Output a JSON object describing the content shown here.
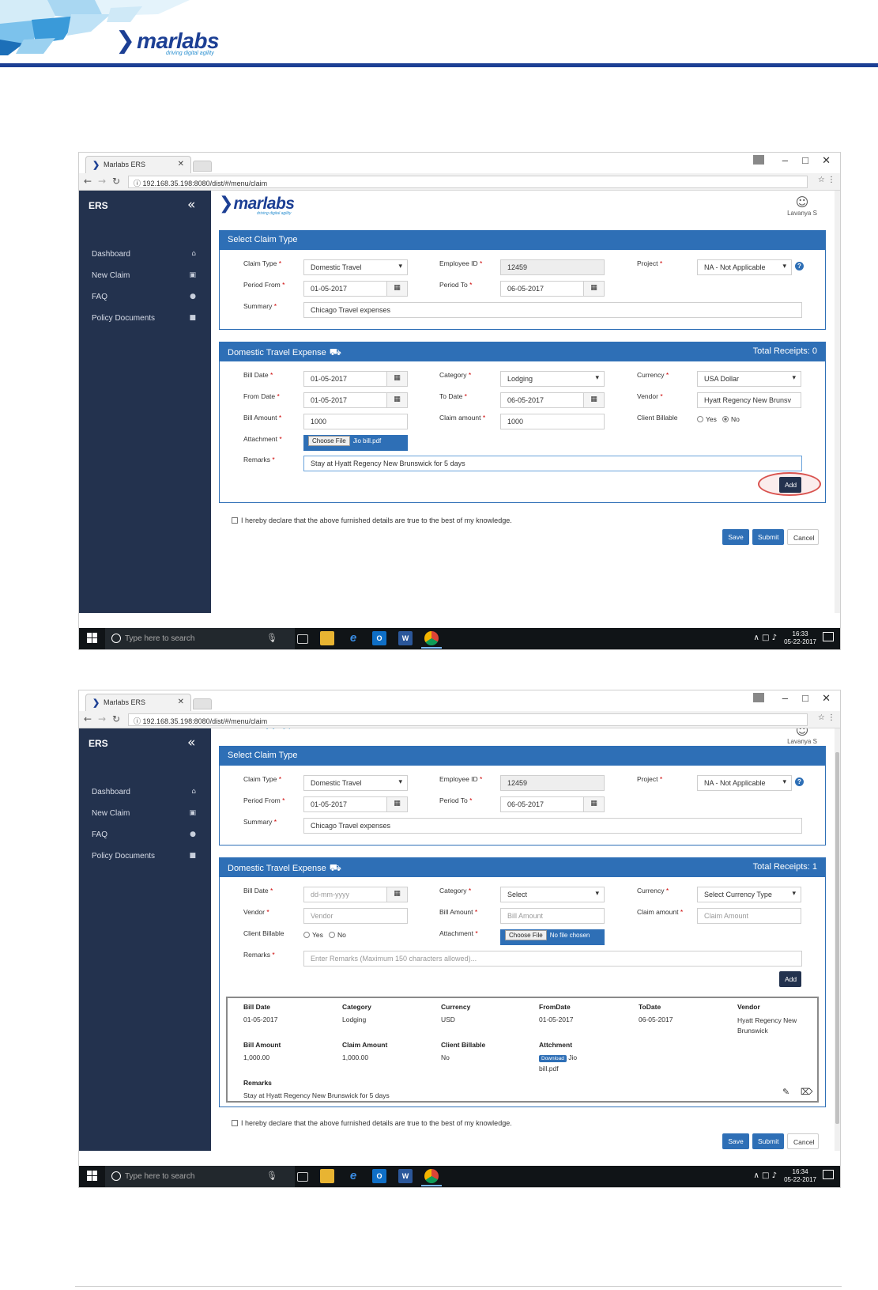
{
  "doc": {
    "logo_text": "marlabs",
    "logo_tagline": "driving digital agility"
  },
  "browser": {
    "tab_title": "Marlabs ERS",
    "url": "192.168.35.198:8080/dist/#/menu/claim"
  },
  "sidebar": {
    "title": "ERS",
    "items": [
      {
        "label": "Dashboard",
        "icon": "home-icon"
      },
      {
        "label": "New Claim",
        "icon": "claim-icon"
      },
      {
        "label": "FAQ",
        "icon": "help-icon"
      },
      {
        "label": "Policy Documents",
        "icon": "file-icon"
      }
    ]
  },
  "app": {
    "logo_text": "marlabs",
    "logo_tagline": "driving digital agility",
    "user_name": "Lavanya S"
  },
  "claim_panel": {
    "title": "Select Claim Type",
    "claim_type_label": "Claim Type",
    "claim_type_value": "Domestic Travel",
    "employee_id_label": "Employee ID",
    "employee_id_value": "12459",
    "project_label": "Project",
    "project_value": "NA - Not Applicable",
    "period_from_label": "Period From",
    "period_from_value": "01-05-2017",
    "period_to_label": "Period To",
    "period_to_value": "06-05-2017",
    "summary_label": "Summary",
    "summary_value": "Chicago Travel expenses"
  },
  "expense_panel_1": {
    "title": "Domestic Travel Expense",
    "total_receipts": "Total Receipts: 0",
    "bill_date_label": "Bill Date",
    "bill_date_value": "01-05-2017",
    "category_label": "Category",
    "category_value": "Lodging",
    "currency_label": "Currency",
    "currency_value": "USA Dollar",
    "from_date_label": "From Date",
    "from_date_value": "01-05-2017",
    "to_date_label": "To Date",
    "to_date_value": "06-05-2017",
    "vendor_label": "Vendor",
    "vendor_value": "Hyatt Regency New Brunsv",
    "bill_amount_label": "Bill Amount",
    "bill_amount_value": "1000",
    "claim_amount_label": "Claim amount",
    "claim_amount_value": "1000",
    "client_billable_label": "Client Billable",
    "yes_label": "Yes",
    "no_label": "No",
    "attachment_label": "Attachment",
    "choose_file": "Choose File",
    "file_name": "Jio bill.pdf",
    "remarks_label": "Remarks",
    "remarks_value": "Stay at Hyatt Regency New Brunswick for 5 days",
    "add_button": "Add"
  },
  "expense_panel_2": {
    "title": "Domestic Travel Expense",
    "total_receipts": "Total Receipts: 1",
    "bill_date_label": "Bill Date",
    "bill_date_placeholder": "dd-mm-yyyy",
    "category_label": "Category",
    "category_value": "Select",
    "currency_label": "Currency",
    "currency_value": "Select Currency Type",
    "vendor_label": "Vendor",
    "vendor_placeholder": "Vendor",
    "bill_amount_label": "Bill Amount",
    "bill_amount_placeholder": "Bill Amount",
    "claim_amount_label": "Claim amount",
    "claim_amount_placeholder": "Claim Amount",
    "client_billable_label": "Client Billable",
    "yes_label": "Yes",
    "no_label": "No",
    "attachment_label": "Attachment",
    "choose_file": "Choose File",
    "file_name": "No file chosen",
    "remarks_label": "Remarks",
    "remarks_placeholder": "Enter Remarks (Maximum 150 characters allowed)...",
    "add_button": "Add"
  },
  "receipt": {
    "headers": [
      "Bill Date",
      "Category",
      "Currency",
      "FromDate",
      "ToDate",
      "Vendor"
    ],
    "values": [
      "01-05-2017",
      "Lodging",
      "USD",
      "01-05-2017",
      "06-05-2017",
      "Hyatt Regency New Brunswick"
    ],
    "headers2": [
      "Bill Amount",
      "Claim Amount",
      "Client Billable",
      "Attchment"
    ],
    "values2": [
      "1,000.00",
      "1,000.00",
      "No"
    ],
    "download_label": "Download",
    "attachment_name": "Jio bill.pdf",
    "remarks_header": "Remarks",
    "remarks_value": "Stay at Hyatt Regency New Brunswick for 5 days"
  },
  "footer": {
    "declaration": "I hereby declare that the above furnished details are true to the best of my knowledge.",
    "save": "Save",
    "submit": "Submit",
    "cancel": "Cancel"
  },
  "taskbar": {
    "search_placeholder": "Type here to search",
    "time_1": "16:33",
    "time_2": "16:34",
    "date": "05-22-2017"
  },
  "colors": {
    "brand": "#1c3f94",
    "panel_header": "#2e6fb6",
    "sidebar": "#23324e",
    "highlight": "#d9534f"
  }
}
